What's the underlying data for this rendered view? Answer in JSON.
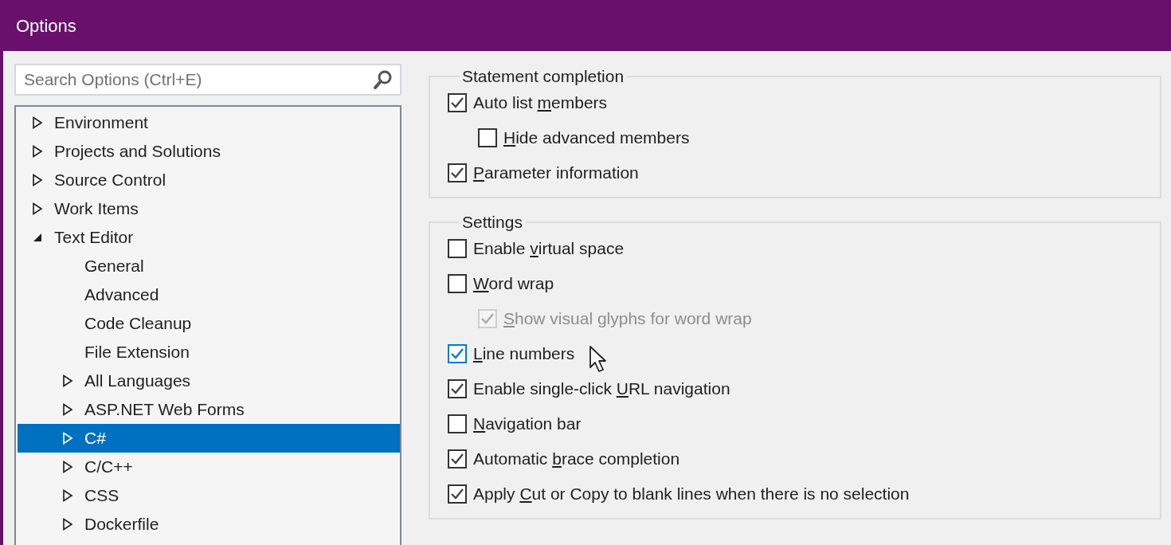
{
  "window": {
    "title": "Options"
  },
  "search": {
    "placeholder": "Search Options (Ctrl+E)"
  },
  "tree": [
    {
      "kind": "folder",
      "label": "Environment",
      "expanded": false,
      "selected": false
    },
    {
      "kind": "folder",
      "label": "Projects and Solutions",
      "expanded": false,
      "selected": false
    },
    {
      "kind": "folder",
      "label": "Source Control",
      "expanded": false,
      "selected": false
    },
    {
      "kind": "folder",
      "label": "Work Items",
      "expanded": false,
      "selected": false
    },
    {
      "kind": "folder",
      "label": "Text Editor",
      "expanded": true,
      "selected": false,
      "children": [
        {
          "kind": "leaf",
          "label": "General",
          "selected": false
        },
        {
          "kind": "leaf",
          "label": "Advanced",
          "selected": false
        },
        {
          "kind": "leaf",
          "label": "Code Cleanup",
          "selected": false
        },
        {
          "kind": "leaf",
          "label": "File Extension",
          "selected": false
        },
        {
          "kind": "folder",
          "label": "All Languages",
          "expanded": false,
          "selected": false
        },
        {
          "kind": "folder",
          "label": "ASP.NET Web Forms",
          "expanded": false,
          "selected": false
        },
        {
          "kind": "folder",
          "label": "C#",
          "expanded": false,
          "selected": true
        },
        {
          "kind": "folder",
          "label": "C/C++",
          "expanded": false,
          "selected": false
        },
        {
          "kind": "folder",
          "label": "CSS",
          "expanded": false,
          "selected": false
        },
        {
          "kind": "folder",
          "label": "Dockerfile",
          "expanded": false,
          "selected": false
        }
      ]
    }
  ],
  "groups": [
    {
      "title": "Statement completion",
      "options": [
        {
          "text_before": "Auto list ",
          "access_key": "m",
          "text_after": "embers",
          "checked": true,
          "disabled": false,
          "hovered": false,
          "children": [
            {
              "access_key": "H",
              "text_after": "ide advanced members",
              "checked": false,
              "disabled": false,
              "hovered": false
            }
          ]
        },
        {
          "access_key": "P",
          "text_after": "arameter information",
          "checked": true,
          "disabled": false,
          "hovered": false
        }
      ]
    },
    {
      "title": "Settings",
      "options": [
        {
          "text_before": "Enable ",
          "access_key": "v",
          "text_after": "irtual space",
          "checked": false,
          "disabled": false,
          "hovered": false
        },
        {
          "access_key": "W",
          "text_after": "ord wrap",
          "checked": false,
          "disabled": false,
          "hovered": false,
          "children": [
            {
              "access_key": "S",
              "text_after": "how visual glyphs for word wrap",
              "checked": true,
              "disabled": true,
              "hovered": false
            }
          ]
        },
        {
          "access_key": "L",
          "text_after": "ine numbers",
          "checked": true,
          "disabled": false,
          "hovered": true
        },
        {
          "text_before": "Enable single-click ",
          "access_key": "U",
          "text_after": "RL navigation",
          "checked": true,
          "disabled": false,
          "hovered": false
        },
        {
          "access_key": "N",
          "text_after": "avigation bar",
          "checked": false,
          "disabled": false,
          "hovered": false
        },
        {
          "text_before": "Automatic ",
          "access_key": "b",
          "text_after": "race completion",
          "checked": true,
          "disabled": false,
          "hovered": false
        },
        {
          "text_before": "Apply ",
          "access_key": "C",
          "text_after": "ut or Copy to blank lines when there is no selection",
          "checked": true,
          "disabled": false,
          "hovered": false
        }
      ]
    }
  ]
}
